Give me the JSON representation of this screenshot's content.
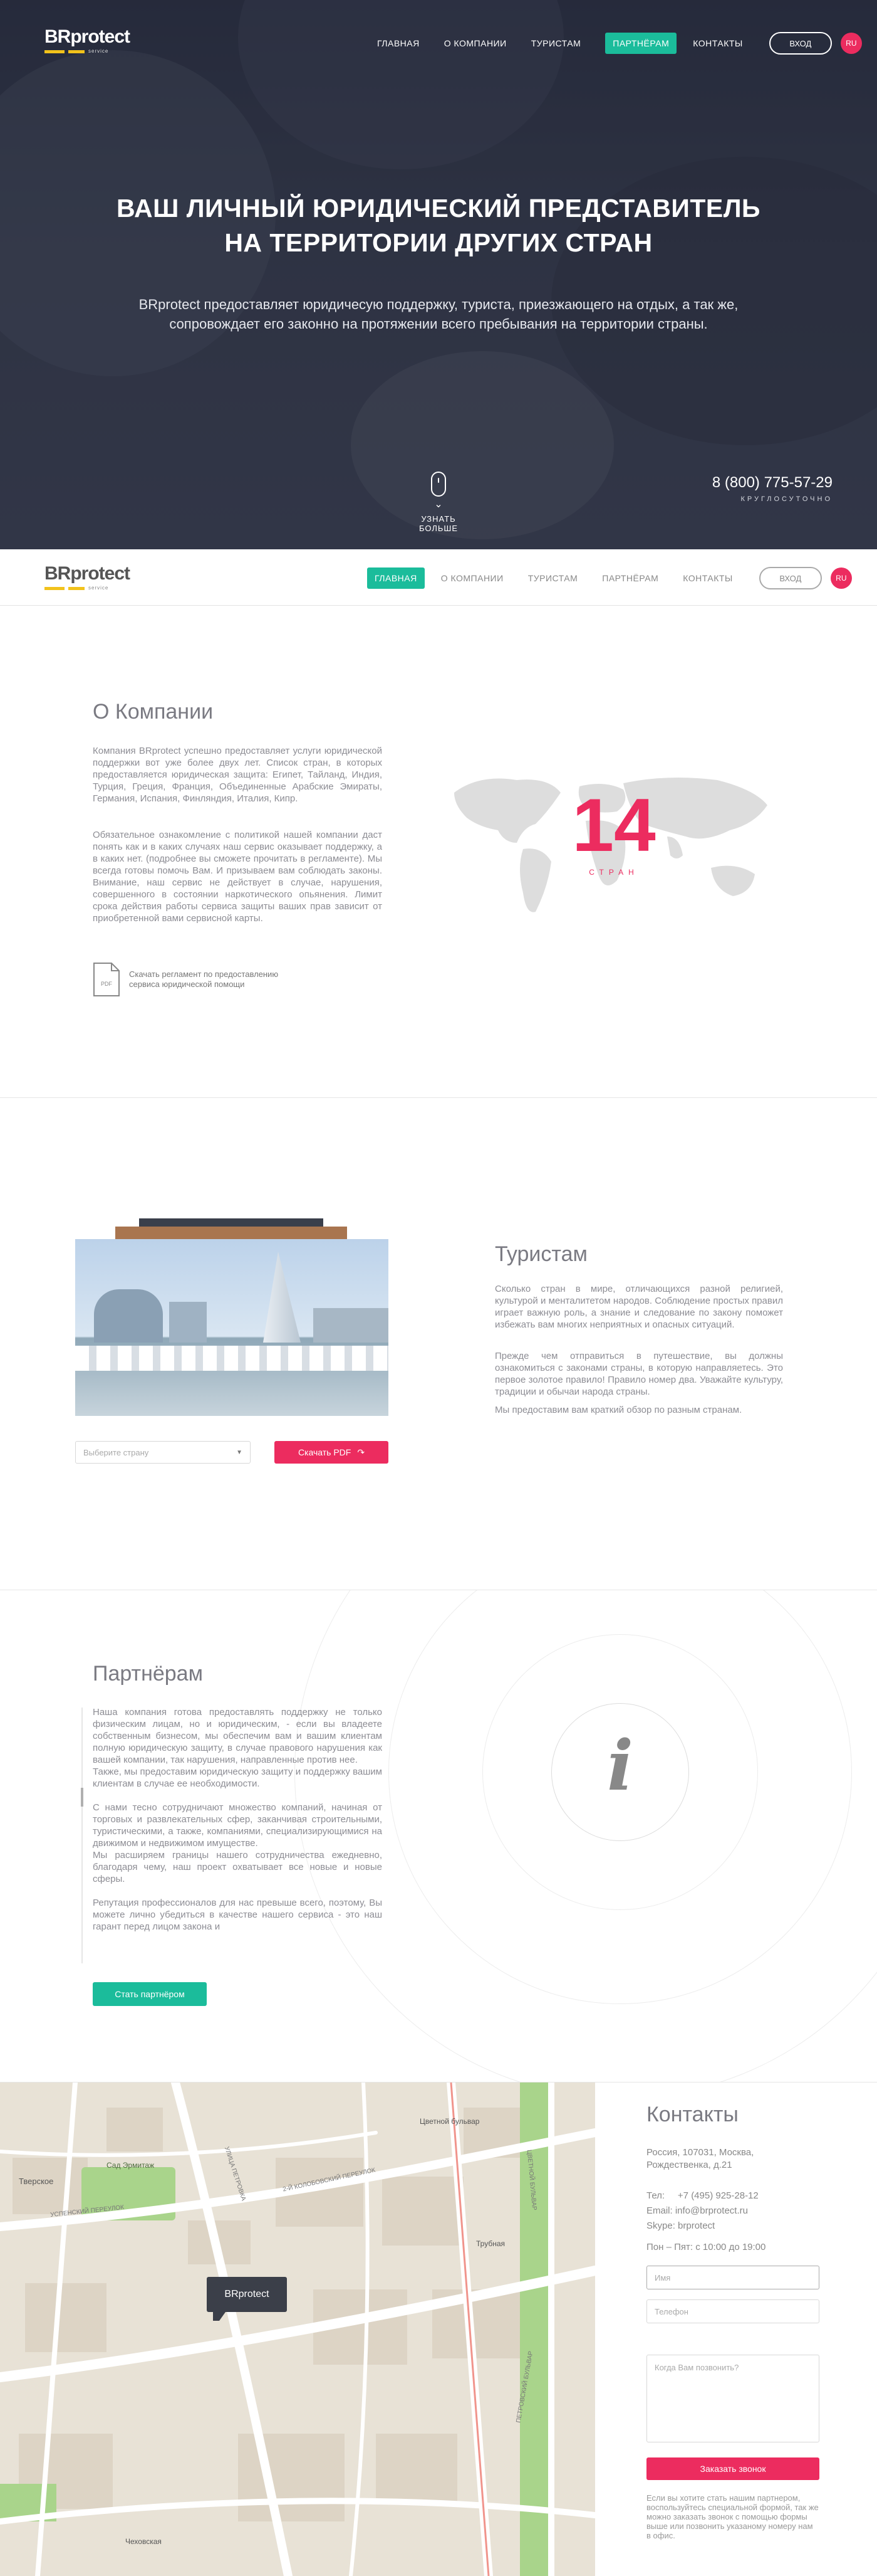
{
  "header": {
    "logo_text": "BRprotect",
    "logo_sub": "service",
    "nav": [
      "ГЛАВНАЯ",
      "О КОМПАНИИ",
      "ТУРИСТАМ",
      "ПАРТНЁРАМ",
      "КОНТАКТЫ"
    ],
    "active_nav": "ПАРТНЁРАМ",
    "login": "ВХОД",
    "lang": "RU"
  },
  "hero": {
    "title_line1": "ВАШ ЛИЧНЫЙ ЮРИДИЧЕСКИЙ ПРЕДСТАВИТЕЛЬ",
    "title_line2": "НА ТЕРРИТОРИИ ДРУГИХ СТРАН",
    "lead": "BRprotect предоставляет юридичесую поддержку, туриста, приезжающего на отдых, а так же, сопровождает его законно на протяжении всего пребывания на территории страны.",
    "scroll_label": "УЗНАТЬ БОЛЬШЕ",
    "phone": "8 (800) 775-57-29",
    "phone_hours": "КРУГЛОСУТОЧНО"
  },
  "sticky_nav": [
    "ГЛАВНАЯ",
    "О КОМПАНИИ",
    "ТУРИСТАМ",
    "ПАРТНЁРАМ",
    "КОНТАКТЫ"
  ],
  "about": {
    "title": "О Компании",
    "p1": "Компания BRprotect успешно предоставляет услуги юридической поддержки вот уже более двух лет. Список стран, в которых предоставляется юридическая защита: Египет, Тайланд, Индия, Турция, Греция, Франция, Объединенные Арабские Эмираты, Германия, Испания, Финляндия, Италия, Кипр.",
    "p2": "Обязательное ознакомление с политикой нашей компании даст понять как и в каких случаях наш сервис оказывает поддержку, а в каких нет. (подробнее вы сможете прочитать в регламенте). Мы всегда готовы помочь Вам. И призываем вам соблюдать законы. Внимание, наш сервис не действует в случае, нарушения, совершенного в состоянии наркотического опьянения. Лимит срока действия работы сервиса защиты ваших прав зависит от приобретенной вами сервисной карты.",
    "pdf_link_line1": "Скачать регламент по предоставлению",
    "pdf_link_line2": "сервиса юридической помощи",
    "pdf_icon": "pdf-file-icon",
    "count": "14",
    "count_label": "СТРАН"
  },
  "tourists": {
    "title": "Туристам",
    "p1": "Сколько стран в мире, отличающихся разной религией, культурой и менталитетом народов. Соблюдение простых правил играет важную роль, а знание и следование по закону поможет избежать вам многих неприятных и опасных ситуаций.",
    "p2": "Прежде чем отправиться в путешествие, вы должны ознакомиться с законами страны, в которую направляетесь. Это первое золотое правило! Правило номер два. Уважайте культуру, традиции и обычаи народа страны.",
    "p3": "Мы предоставим вам краткий обзор по разным странам.",
    "select_placeholder": "Выберите страну",
    "download_label": "Скачать PDF"
  },
  "partners": {
    "title": "Партнёрам",
    "p1": "Наша компания готова предоставлять поддержку не только физическим лицам, но и юридическим, - если вы владеете собственным бизнесом, мы обеспечим вам и вашим клиентам полную юридическую защиту, в случае правового нарушения как вашей компании, так нарушения, направленные против нее.",
    "p2": "Также, мы предоставим юридическую защиту и поддержку вашим клиентам в случае ее необходимости.",
    "p3": "С нами тесно сотрудничают множество компаний, начиная от торговых и развлекательных сфер, заканчивая строительными, туристическими, а также, компаниями, специализирующимися на движимом и недвижимом имуществе.",
    "p4": "Мы расширяем границы нашего сотрудничества ежедневно, благодаря чему, наш проект охватывает все новые и новые сферы.",
    "p5": "Репутация профессионалов для нас превыше всего, поэтому, Вы можете лично убедиться в качестве нашего сервиса - это наш гарант перед лицом закона и",
    "button": "Стать партнёром",
    "info_icon": "info-icon"
  },
  "contacts": {
    "title": "Контакты",
    "address": "Россия, 107031, Москва, Рождественка, д.21",
    "tel": "Тел:     +7 (495) 925-28-12",
    "email": "Email: info@brprotect.ru",
    "skype": "Skype: brprotect",
    "hours": "Пон – Пят: с 10:00 до 19:00",
    "name_placeholder": "Имя",
    "phone_placeholder": "Телефон",
    "question_placeholder": "Когда Вам позвонить?",
    "submit": "Заказать звонок",
    "note": "Если вы хотите стать нашим партнером, воспользуйтесь специальной формой, так же можно заказать звонок с помощью формы выше или позвонить указаному номеру нам в офис.",
    "map_marker": "BRprotect",
    "map_labels": [
      "Тверское",
      "Сад Эрмитаж",
      "Цветной бульвар",
      "Трубная",
      "Чеховская",
      "УСПЕНСКИЙ ПЕРЕУЛОК",
      "2-Й КОЛОБОВСКИЙ ПЕРЕУЛОК",
      "УЛИЦА ПЕТРОВКА",
      "ЦВЕТНОЙ БУЛЬВАР",
      "ПЕТРОВСКИЙ БУЛЬВАР"
    ]
  },
  "colors": {
    "accent_green": "#1bbc9b",
    "accent_pink": "#ec2c5f",
    "logo_yellow": "#f2c21b"
  }
}
